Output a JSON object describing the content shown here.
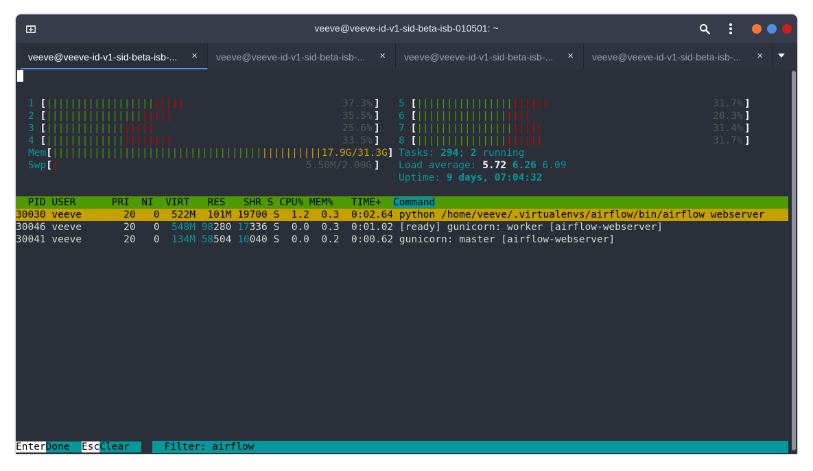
{
  "window": {
    "title": "veeve@veeve-id-v1-sid-beta-isb-010501: ~",
    "controls": {
      "minimize_color": "#f27835",
      "maximize_color": "#4a90e2",
      "close_color": "#cc2020"
    }
  },
  "tabs": [
    {
      "label": "veeve@veeve-id-v1-sid-beta-isb-...",
      "active": true
    },
    {
      "label": "veeve@veeve-id-v1-sid-beta-isb-...",
      "active": false
    },
    {
      "label": "veeve@veeve-id-v1-sid-beta-isb-...",
      "active": false
    },
    {
      "label": "veeve@veeve-id-v1-sid-beta-isb-...",
      "active": false
    }
  ],
  "tab_close_glyph": "×",
  "icons": {
    "new_tab": "new-tab-icon",
    "search": "search-icon",
    "menu": "kebab-menu-icon",
    "dropdown": "chevron-down-icon"
  },
  "htop": {
    "cpus_left": [
      {
        "id": "1",
        "green": "||||||||||||||||||",
        "red": "|||||",
        "pct": "37.3%"
      },
      {
        "id": "2",
        "green": "||||||||||||||||",
        "red": "|||||",
        "pct": "35.5%"
      },
      {
        "id": "3",
        "green": "|||||||||||||",
        "red": "|||||",
        "pct": "25.6%"
      },
      {
        "id": "4",
        "green": "|||||||||||||",
        "red": "||||||||",
        "pct": "33.5%"
      }
    ],
    "cpus_right": [
      {
        "id": "5",
        "green": "||||||||||||||||",
        "red": "||||||",
        "pct": "31.7%"
      },
      {
        "id": "6",
        "green": "|||||||||||||||",
        "red": "||||",
        "pct": "28.3%"
      },
      {
        "id": "7",
        "green": "||||||||||||||||",
        "red": "|||||",
        "pct": "31.4%"
      },
      {
        "id": "8",
        "green": "|||||||||||||||",
        "red": "||||||",
        "pct": "31.7%"
      }
    ],
    "mem": {
      "label": "Mem",
      "green": "|||||||||||||||||||||||||||||||||||",
      "yellow": "||||||||||",
      "value": "17.9G/31.3G"
    },
    "swp": {
      "label": "Swp",
      "red": "|",
      "value": "5.50M/2.00G"
    },
    "tasks": {
      "label": "Tasks: ",
      "count": "294",
      "sep": "; ",
      "running": "2",
      "running_label": " running"
    },
    "load": {
      "label": "Load average: ",
      "v1": "5.72",
      "v5": "6.26",
      "v15": "6.09"
    },
    "uptime": {
      "label": "Uptime: ",
      "value": "9 days, 07:04:32"
    },
    "columns": {
      "pid": "PID",
      "user": "USER",
      "pri": "PRI",
      "ni": "NI",
      "virt": "VIRT",
      "res": "RES",
      "shr": "SHR",
      "s": "S",
      "cpu": "CPU%",
      "mem": "MEM%",
      "time": "TIME+",
      "command": "Command"
    },
    "rows": [
      {
        "pid": "30030",
        "user": "veeve",
        "pri": "20",
        "ni": "0",
        "virt_a": "522M",
        "res_a": "101M",
        "res_b": "",
        "shr_a": "19700",
        "shr_b": "",
        "s": "S",
        "cpu": "1.2",
        "mem": "0.3",
        "time": "0:02.64",
        "command": "python /home/veeve/.virtualenvs/airflow/bin/airflow webserver"
      },
      {
        "pid": "30046",
        "user": "veeve",
        "pri": "20",
        "ni": "0",
        "virt_a": "548M",
        "res_a": "98",
        "res_b": "280",
        "shr_a": "17",
        "shr_b": "336",
        "s": "S",
        "cpu": "0.0",
        "mem": "0.3",
        "time": "0:01.02",
        "command": "[ready] gunicorn: worker [airflow-webserver]"
      },
      {
        "pid": "30041",
        "user": "veeve",
        "pri": "20",
        "ni": "0",
        "virt_a": "134M",
        "res_a": "58",
        "res_b": "504",
        "shr_a": "10",
        "shr_b": "040",
        "s": "S",
        "cpu": "0.0",
        "mem": "0.2",
        "time": "0:00.62",
        "command": "gunicorn: master [airflow-webserver]"
      }
    ],
    "footer": {
      "key1": "Enter",
      "label1": "Done  ",
      "key2": "Esc",
      "label2": "Clear  ",
      "filter": "  Filter: airflow"
    }
  }
}
